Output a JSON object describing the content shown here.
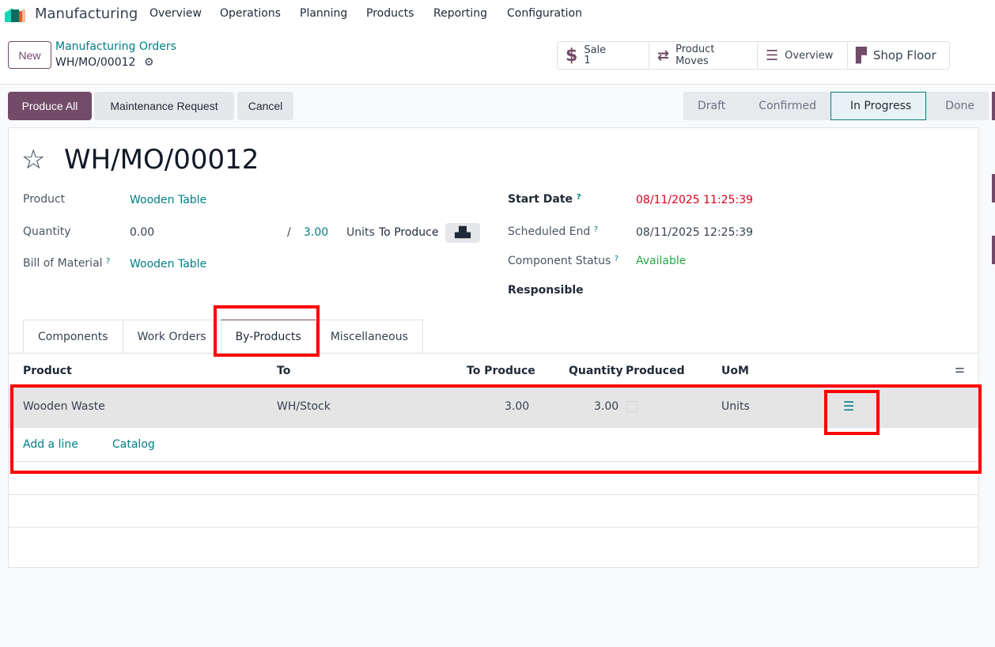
{
  "nav": {
    "app": "Manufacturing",
    "menu": [
      "Overview",
      "Operations",
      "Planning",
      "Products",
      "Reporting",
      "Configuration"
    ]
  },
  "control": {
    "new": "New",
    "breadcrumb": "Manufacturing Orders",
    "record": "WH/MO/00012"
  },
  "smart": {
    "sale_label": "Sale",
    "sale_count": "1",
    "moves": "Product Moves",
    "overview": "Overview",
    "shop_floor": "Shop Floor"
  },
  "actions": {
    "produce_all": "Produce All",
    "maintenance": "Maintenance Request",
    "cancel": "Cancel"
  },
  "statusbar": [
    "Draft",
    "Confirmed",
    "In Progress",
    "Done"
  ],
  "form": {
    "title": "WH/MO/00012",
    "product_label": "Product",
    "product": "Wooden Table",
    "quantity_label": "Quantity",
    "quantity": "0.00",
    "slash": "/",
    "qty_to_produce": "3.00",
    "uom": "Units",
    "to_produce": "To Produce",
    "bom_label": "Bill of Material",
    "bom": "Wooden Table",
    "start_label": "Start Date",
    "start": "08/11/2025 11:25:39",
    "end_label": "Scheduled End",
    "end": "08/11/2025 12:25:39",
    "comp_label": "Component Status",
    "comp": "Available",
    "resp_label": "Responsible",
    "help": "?"
  },
  "tabs": [
    "Components",
    "Work Orders",
    "By-Products",
    "Miscellaneous"
  ],
  "table": {
    "headers": [
      "Product",
      "To",
      "To Produce",
      "Quantity",
      "Produced",
      "UoM"
    ],
    "rows": [
      {
        "product": "Wooden Waste",
        "to": "WH/Stock",
        "to_produce": "3.00",
        "quantity": "3.00",
        "uom": "Units"
      }
    ],
    "add_line": "Add a line",
    "catalog": "Catalog"
  },
  "colors": {
    "brand": "#714b67",
    "link": "#017e84",
    "danger": "#d9001b",
    "success": "#28a745",
    "highlight": "#ff0000"
  }
}
